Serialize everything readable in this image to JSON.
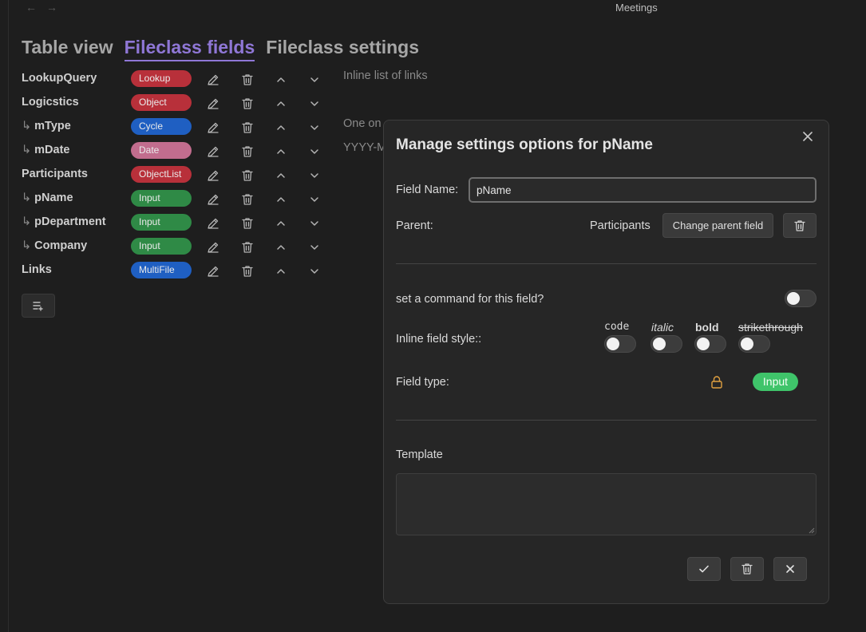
{
  "window": {
    "title": "Meetings"
  },
  "tabs": [
    {
      "label": "Table view",
      "active": false
    },
    {
      "label": "Fileclass fields",
      "active": true
    },
    {
      "label": "Fileclass settings",
      "active": false
    }
  ],
  "fields": [
    {
      "name": "LookupQuery",
      "child": false,
      "type": "Lookup",
      "color": "#b8303a"
    },
    {
      "name": "Logicstics",
      "child": false,
      "type": "Object",
      "color": "#b8303a"
    },
    {
      "name": "mType",
      "child": true,
      "type": "Cycle",
      "color": "#1f5fc2"
    },
    {
      "name": "mDate",
      "child": true,
      "type": "Date",
      "color": "#c26d8e"
    },
    {
      "name": "Participants",
      "child": false,
      "type": "ObjectList",
      "color": "#b8303a"
    },
    {
      "name": "pName",
      "child": true,
      "type": "Input",
      "color": "#2f8a46"
    },
    {
      "name": "pDepartment",
      "child": true,
      "type": "Input",
      "color": "#2f8a46"
    },
    {
      "name": "Company",
      "child": true,
      "type": "Input",
      "color": "#2f8a46"
    },
    {
      "name": "Links",
      "child": false,
      "type": "MultiFile",
      "color": "#1f5fc2"
    }
  ],
  "background_texts": {
    "line1": "Inline list of links",
    "line2": "One on",
    "line3": "YYYY-M"
  },
  "modal": {
    "title": "Manage settings options for pName",
    "field_name_label": "Field Name:",
    "field_name_value": "pName",
    "parent_label": "Parent:",
    "parent_value": "Participants",
    "change_parent_label": "Change parent field",
    "command_label": "set a command for this field?",
    "inline_style_label": "Inline field style::",
    "styles": {
      "code": "code",
      "italic": "italic",
      "bold": "bold",
      "strikethrough": "strikethrough"
    },
    "field_type_label": "Field type:",
    "field_type_value": "Input",
    "template_label": "Template",
    "template_value": ""
  },
  "icons": {
    "back": "arrow-left-icon",
    "forward": "arrow-right-icon",
    "edit": "pencil-icon",
    "delete": "trash-icon",
    "move_up": "chevron-up-icon",
    "move_down": "chevron-down-icon",
    "add": "list-plus-icon",
    "close": "close-icon",
    "lock": "lock-icon",
    "confirm": "check-icon"
  },
  "colors": {
    "accent": "#8f77d6",
    "input_badge": "#3fc46a",
    "lock": "#e0a040"
  }
}
